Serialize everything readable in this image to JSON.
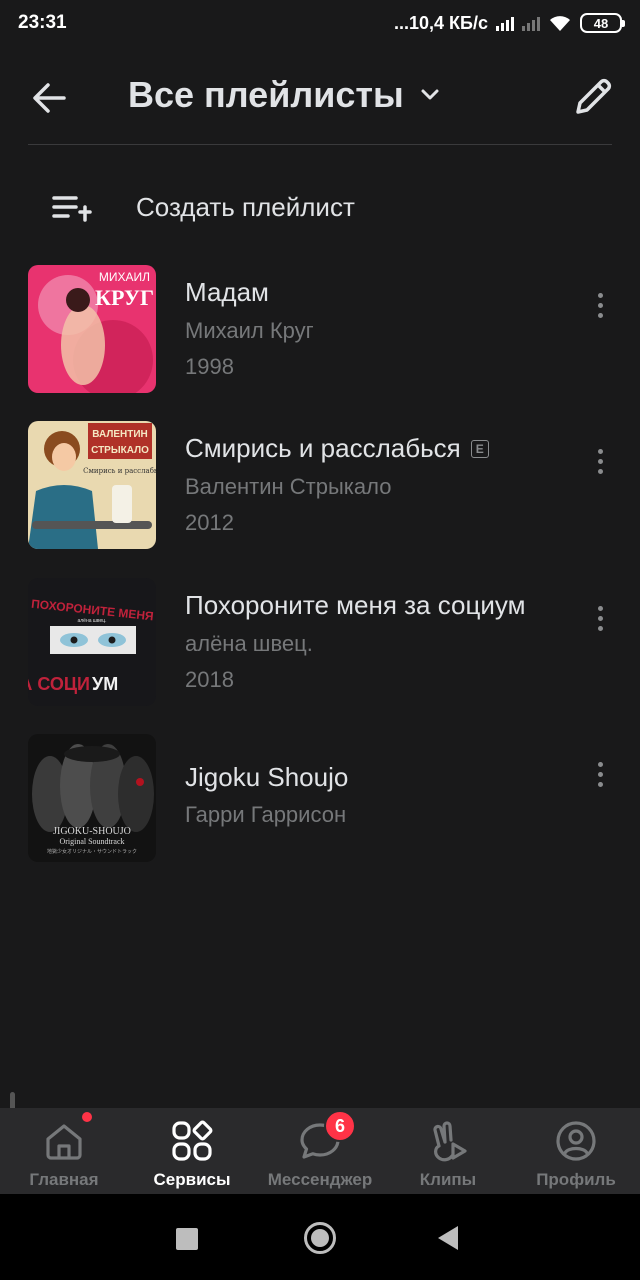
{
  "status_bar": {
    "time": "23:31",
    "network_speed": "...10,4 КБ/с",
    "battery": "48",
    "icons": [
      "signal-icon",
      "signal-weak-icon",
      "wifi-icon",
      "battery-icon"
    ]
  },
  "header": {
    "title": "Все плейлисты",
    "back_icon": "back-arrow-icon",
    "dropdown_icon": "chevron-down-icon",
    "edit_icon": "pencil-icon"
  },
  "create_playlist": {
    "label": "Создать плейлист",
    "icon": "playlist-add-icon"
  },
  "playlists": [
    {
      "title": "Мадам",
      "artist": "Михаил Круг",
      "year": "1998",
      "explicit": false,
      "cover_text": [
        "МИХАИЛ",
        "КРУГ"
      ],
      "cover_colors": [
        "#e8336f",
        "#f3a1c0",
        "#c81e52"
      ]
    },
    {
      "title": "Смирись и расслабься",
      "artist": "Валентин Стрыкало",
      "year": "2012",
      "explicit": true,
      "explicit_label": "E",
      "cover_text": [
        "ВАЛЕНТИН",
        "СТРЫКАЛО",
        "Смирись и расслабься!"
      ],
      "cover_colors": [
        "#e9d9b0",
        "#b03128",
        "#2a6e86"
      ]
    },
    {
      "title": "Похороните меня за социум",
      "artist": "алёна швец.",
      "year": "2018",
      "explicit": false,
      "cover_text": [
        "ПОХОРОНИТЕ МЕНЯ",
        "ЗА СОЦИ",
        "УМ",
        "алёна швец."
      ],
      "cover_colors": [
        "#17171a",
        "#c0223b",
        "#8fc3d8"
      ]
    },
    {
      "title": "Jigoku Shoujo",
      "artist": "Гарри Гаррисон",
      "year": "",
      "explicit": false,
      "cover_text": [
        "JIGOKU-SHOUJO",
        "Original Soundtrack",
        "地獄少女オリジナル・サウンドトラック"
      ],
      "cover_colors": [
        "#121212",
        "#d9d9d9",
        "#b3121f"
      ]
    }
  ],
  "more_icon": "more-vertical-icon",
  "tab_bar": {
    "tabs": [
      {
        "label": "Главная",
        "icon": "home-icon",
        "active": false,
        "dot_badge": true
      },
      {
        "label": "Сервисы",
        "icon": "services-icon",
        "active": true
      },
      {
        "label": "Мессенджер",
        "icon": "message-icon",
        "active": false,
        "badge": "6"
      },
      {
        "label": "Клипы",
        "icon": "clips-icon",
        "active": false
      },
      {
        "label": "Профиль",
        "icon": "profile-icon",
        "active": false
      }
    ]
  },
  "system_nav": [
    "recents-button",
    "home-button",
    "back-button"
  ],
  "colors": {
    "background": "#19191a",
    "tab_bar": "#2a2a2c",
    "text_primary": "#e1e3e6",
    "text_secondary": "#76787a",
    "badge": "#ff3347"
  }
}
